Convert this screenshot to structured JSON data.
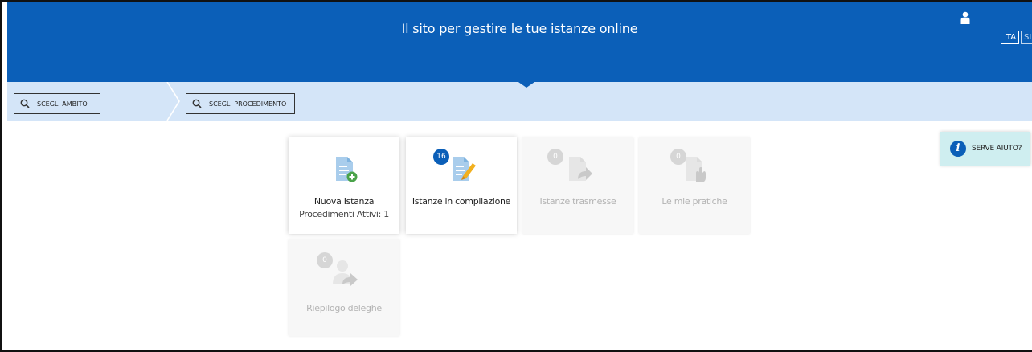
{
  "header": {
    "title": "Il sito per gestire le tue istanze online",
    "languages": [
      {
        "code": "ITA",
        "active": true
      },
      {
        "code": "SLO",
        "active": false
      }
    ],
    "icons": {
      "user": "user-icon"
    },
    "colors": {
      "primary": "#0b5fb8",
      "crumbbar": "#d4e5f8",
      "help_bg": "#cfeef0"
    }
  },
  "breadcrumb": {
    "ambito_label": "SCEGLI AMBITO",
    "procedimento_label": "SCEGLI PROCEDIMENTO",
    "icons": {
      "search": "search-icon",
      "separator": "chevron-right-icon"
    }
  },
  "tiles": [
    {
      "label": "Nuova Istanza",
      "sublabel": "Procedimenti Attivi: 1",
      "icon": "new-document-icon",
      "enabled": true
    },
    {
      "label": "Istanze in compilazione",
      "badge": "16",
      "icon": "edit-document-icon",
      "enabled": true
    },
    {
      "label": "Istanze trasmesse",
      "badge": "0",
      "icon": "send-document-icon",
      "enabled": false
    },
    {
      "label": "Le mie pratiche",
      "badge": "0",
      "icon": "hand-document-icon",
      "enabled": false
    },
    {
      "label": "Riepilogo deleghe",
      "badge": "0",
      "icon": "delegate-icon",
      "enabled": false
    }
  ],
  "help": {
    "label": "SERVE AIUTO?",
    "icon": "info-icon"
  }
}
